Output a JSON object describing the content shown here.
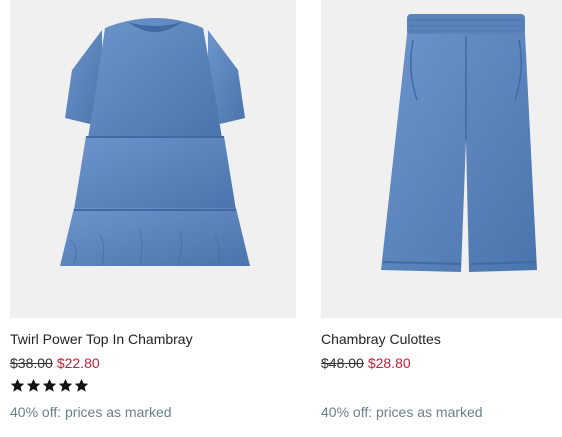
{
  "products": [
    {
      "name": "Twirl Power Top In Chambray",
      "original_price": "$38.00",
      "sale_price": "$22.80",
      "rating_stars": 5,
      "promo": "40% off: prices as marked",
      "image_icon": "denim-top-image"
    },
    {
      "name": "Chambray Culottes",
      "original_price": "$48.00",
      "sale_price": "$28.80",
      "promo": "40% off: prices as marked",
      "image_icon": "denim-culottes-image"
    }
  ],
  "colors": {
    "sale": "#c41e3a",
    "promo": "#6a7f8e",
    "image_bg": "#f0f0f0",
    "denim": "#5b84bd"
  }
}
